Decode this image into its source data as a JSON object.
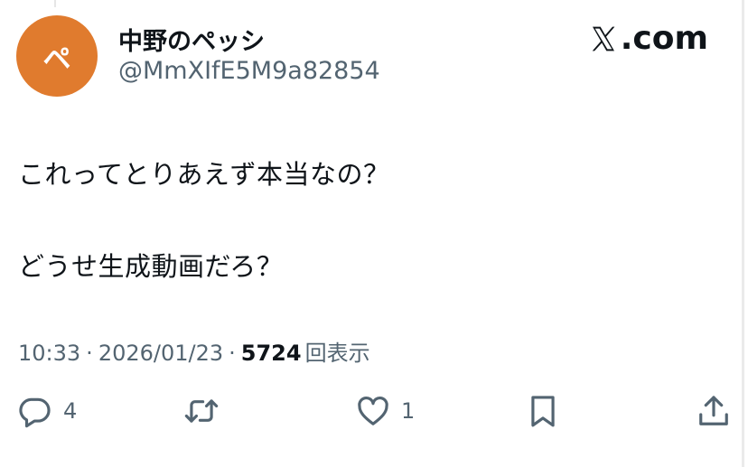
{
  "author": {
    "avatar_letter": "ペ",
    "avatar_color": "#e07b2e",
    "display_name": "中野のペッシ",
    "handle": "@MmXIfE5M9a82854"
  },
  "brand": {
    "text": ".com",
    "logo_icon": "x-logo-icon"
  },
  "tweet": {
    "line1": "これってとりあえず本当なの？",
    "line2": "どうせ生成動画だろ？"
  },
  "meta": {
    "time": "10:33",
    "separator": "·",
    "date": "2026/01/23",
    "views": "5724",
    "views_label": "回表示"
  },
  "actions": {
    "reply": {
      "icon": "reply-bubble-icon",
      "count": "4"
    },
    "retweet": {
      "icon": "retweet-icon"
    },
    "like": {
      "icon": "heart-icon",
      "count": "1"
    },
    "bookmark": {
      "icon": "bookmark-icon"
    },
    "share": {
      "icon": "share-icon"
    }
  },
  "colors": {
    "text_primary": "#0f1419",
    "text_secondary": "#536471",
    "icon": "#536471"
  }
}
